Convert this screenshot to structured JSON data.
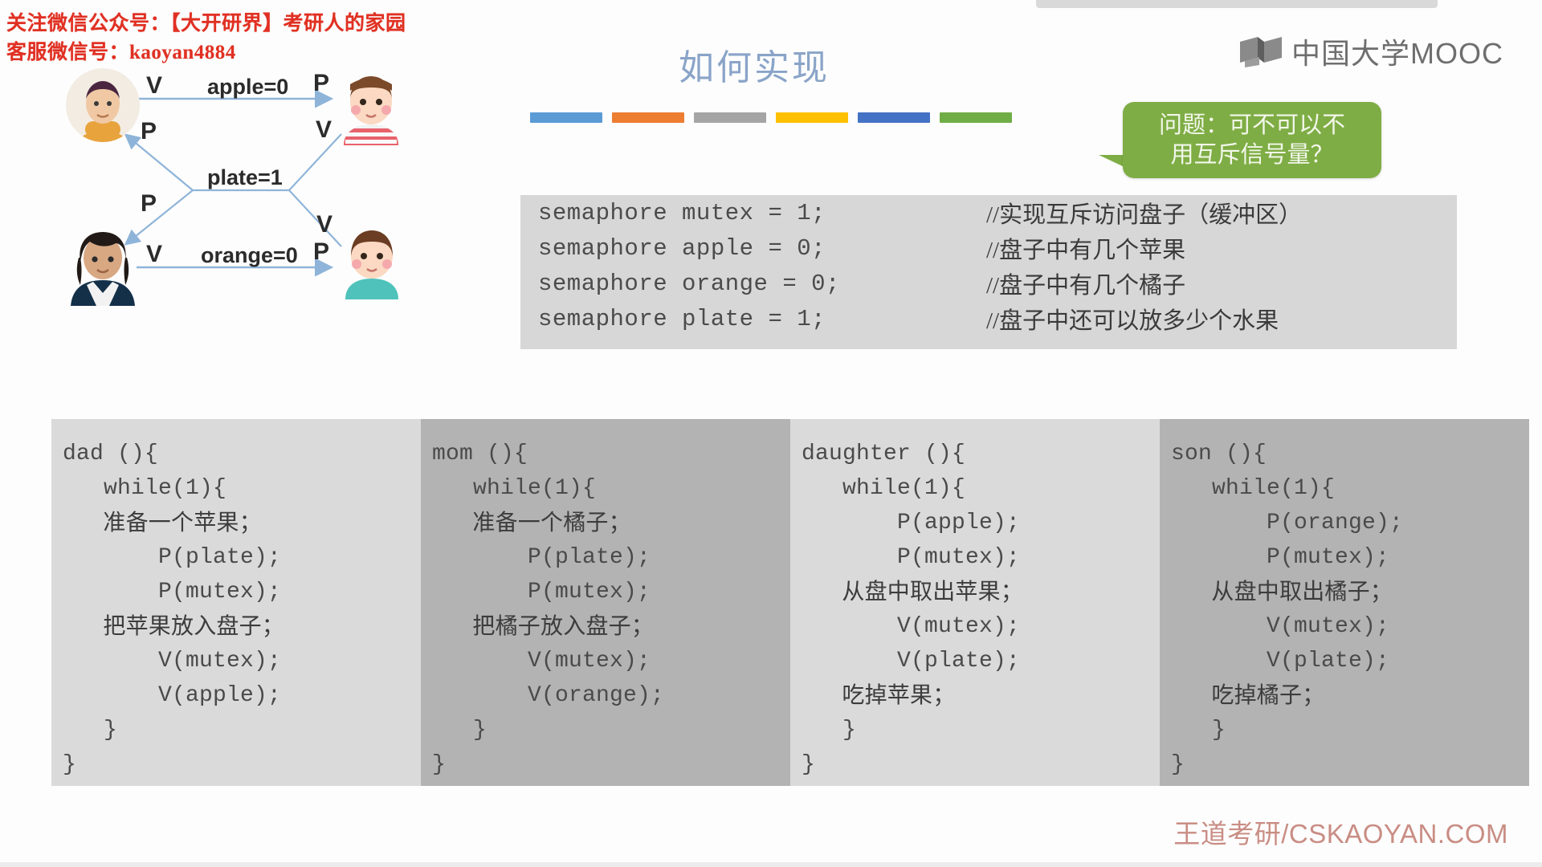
{
  "watermark": {
    "line1": "关注微信公众号：【大开研界】考研人的家园",
    "line2": "客服微信号：kaoyan4884",
    "color": "#e03022"
  },
  "brand": {
    "logo_text": "中国大学MOOC",
    "logo_icon": "book-logo-icon"
  },
  "slide": {
    "title": "如何实现",
    "title_color": "#8aa4c8",
    "color_bars": [
      "#5b9bd5",
      "#ed7d31",
      "#a5a5a5",
      "#ffc000",
      "#4472c4",
      "#70ad47"
    ]
  },
  "diagram": {
    "nodes": [
      {
        "name": "dad-avatar",
        "label": "dad"
      },
      {
        "name": "daughter-avatar",
        "label": "daughter"
      },
      {
        "name": "mom-avatar",
        "label": "mom"
      },
      {
        "name": "son-avatar",
        "label": "son"
      }
    ],
    "edges": [
      {
        "label": "apple=0",
        "from_op": "V",
        "to_op": "P"
      },
      {
        "label": "plate=1",
        "from_op_top": "P",
        "from_op_bottom": "P",
        "to_op_top": "V",
        "to_op_bottom": "V"
      },
      {
        "label": "orange=0",
        "from_op": "V",
        "to_op": "P"
      }
    ],
    "labels": {
      "apple": "apple=0",
      "plate": "plate=1",
      "orange": "orange=0",
      "v_top": "V",
      "p_top_right": "P",
      "p_upper_left": "P",
      "v_upper_right": "V",
      "p_lower_left": "P",
      "v_lower_right": "V",
      "v_bottom": "V",
      "p_bottom_right": "P"
    },
    "arrow_color": "#8fb4d9"
  },
  "semaphores": {
    "rows": [
      {
        "code": "semaphore mutex  = 1;",
        "note": "//实现互斥访问盘子（缓冲区）"
      },
      {
        "code": "semaphore apple  = 0;",
        "note": "//盘子中有几个苹果"
      },
      {
        "code": "semaphore orange = 0;",
        "note": "//盘子中有几个橘子"
      },
      {
        "code": "semaphore plate  = 1;",
        "note": "//盘子中还可以放多少个水果"
      }
    ]
  },
  "callout": {
    "line1": "问题：可不可以不",
    "line2": "用互斥信号量？",
    "color": "#7fad45"
  },
  "panels": [
    {
      "name": "dad",
      "shade": "light",
      "lines": [
        {
          "text": "dad (){",
          "cn": false
        },
        {
          "text": "   while(1){",
          "cn": false
        },
        {
          "text": "       准备一个苹果；",
          "cn": true
        },
        {
          "text": "       P(plate);",
          "cn": false
        },
        {
          "text": "       P(mutex);",
          "cn": false
        },
        {
          "text": "       把苹果放入盘子；",
          "cn": true
        },
        {
          "text": "       V(mutex);",
          "cn": false
        },
        {
          "text": "       V(apple);",
          "cn": false
        },
        {
          "text": "   }",
          "cn": false
        },
        {
          "text": "}",
          "cn": false
        }
      ]
    },
    {
      "name": "mom",
      "shade": "dark",
      "lines": [
        {
          "text": "mom (){",
          "cn": false
        },
        {
          "text": "   while(1){",
          "cn": false
        },
        {
          "text": "       准备一个橘子；",
          "cn": true
        },
        {
          "text": "       P(plate);",
          "cn": false
        },
        {
          "text": "       P(mutex);",
          "cn": false
        },
        {
          "text": "       把橘子放入盘子；",
          "cn": true
        },
        {
          "text": "       V(mutex);",
          "cn": false
        },
        {
          "text": "       V(orange);",
          "cn": false
        },
        {
          "text": "   }",
          "cn": false
        },
        {
          "text": "}",
          "cn": false
        }
      ]
    },
    {
      "name": "daughter",
      "shade": "light",
      "lines": [
        {
          "text": "daughter (){",
          "cn": false
        },
        {
          "text": "   while(1){",
          "cn": false
        },
        {
          "text": "       P(apple);",
          "cn": false
        },
        {
          "text": "       P(mutex);",
          "cn": false
        },
        {
          "text": "       从盘中取出苹果；",
          "cn": true
        },
        {
          "text": "       V(mutex);",
          "cn": false
        },
        {
          "text": "       V(plate);",
          "cn": false
        },
        {
          "text": "       吃掉苹果；",
          "cn": true
        },
        {
          "text": "   }",
          "cn": false
        },
        {
          "text": "}",
          "cn": false
        }
      ]
    },
    {
      "name": "son",
      "shade": "dark",
      "lines": [
        {
          "text": "son (){",
          "cn": false
        },
        {
          "text": "   while(1){",
          "cn": false
        },
        {
          "text": "       P(orange);",
          "cn": false
        },
        {
          "text": "       P(mutex);",
          "cn": false
        },
        {
          "text": "       从盘中取出橘子；",
          "cn": true
        },
        {
          "text": "       V(mutex);",
          "cn": false
        },
        {
          "text": "       V(plate);",
          "cn": false
        },
        {
          "text": "       吃掉橘子；",
          "cn": true
        },
        {
          "text": "   }",
          "cn": false
        },
        {
          "text": "}",
          "cn": false
        }
      ]
    }
  ],
  "footer": {
    "text": "王道考研/CSKAOYAN.COM",
    "color": "#c98d84"
  }
}
